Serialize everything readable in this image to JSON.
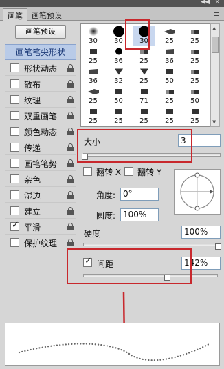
{
  "window": {
    "collapse_glyph": "◀◀",
    "close_glyph": "×"
  },
  "tabs": [
    {
      "label": "画笔"
    },
    {
      "label": "画笔预设"
    }
  ],
  "panel_menu_glyph": "≡",
  "preset_button": "画笔预设",
  "sidebar": {
    "items": [
      {
        "label": "画笔笔尖形状",
        "checkbox": false,
        "lock": false,
        "selected": true
      },
      {
        "label": "形状动态",
        "checked": false,
        "lock": true
      },
      {
        "label": "散布",
        "checked": false,
        "lock": true
      },
      {
        "label": "纹理",
        "checked": false,
        "lock": true
      },
      {
        "label": "双重画笔",
        "checked": false,
        "lock": true
      },
      {
        "label": "颜色动态",
        "checked": false,
        "lock": true
      },
      {
        "label": "传递",
        "checked": false,
        "lock": true
      },
      {
        "label": "画笔笔势",
        "checked": false,
        "lock": true
      },
      {
        "label": "杂色",
        "checked": false,
        "lock": true
      },
      {
        "label": "湿边",
        "checked": false,
        "lock": true
      },
      {
        "label": "建立",
        "checked": false,
        "lock": true
      },
      {
        "label": "平滑",
        "checked": true,
        "lock": true
      },
      {
        "label": "保护纹理",
        "checked": false,
        "lock": true
      }
    ]
  },
  "brush_tips": {
    "rows": [
      [
        "30",
        "30",
        "30",
        "25",
        "25"
      ],
      [
        "25",
        "36",
        "25",
        "36",
        "25"
      ],
      [
        "36",
        "32",
        "25",
        "50",
        "25"
      ],
      [
        "25",
        "50",
        "71",
        "25",
        "50"
      ],
      [
        "25",
        "25",
        "25",
        "25",
        "25"
      ]
    ],
    "selected_row": 0,
    "selected_col": 2
  },
  "size": {
    "label": "大小",
    "value": "3",
    "slider_fraction": 0.01
  },
  "flip_x": {
    "label": "翻转 X",
    "checked": false
  },
  "flip_y": {
    "label": "翻转 Y",
    "checked": false
  },
  "angle": {
    "label": "角度:",
    "value": "0°"
  },
  "roundness": {
    "label": "圆度:",
    "value": "100%"
  },
  "hardness": {
    "label": "硬度",
    "value": "100%",
    "slider_fraction": 1.0
  },
  "spacing": {
    "label": "间距",
    "value": "142%",
    "checked": true,
    "slider_fraction": 0.6
  },
  "colors": {
    "highlight": "#c8282d",
    "selection": "#b9cbe8"
  }
}
